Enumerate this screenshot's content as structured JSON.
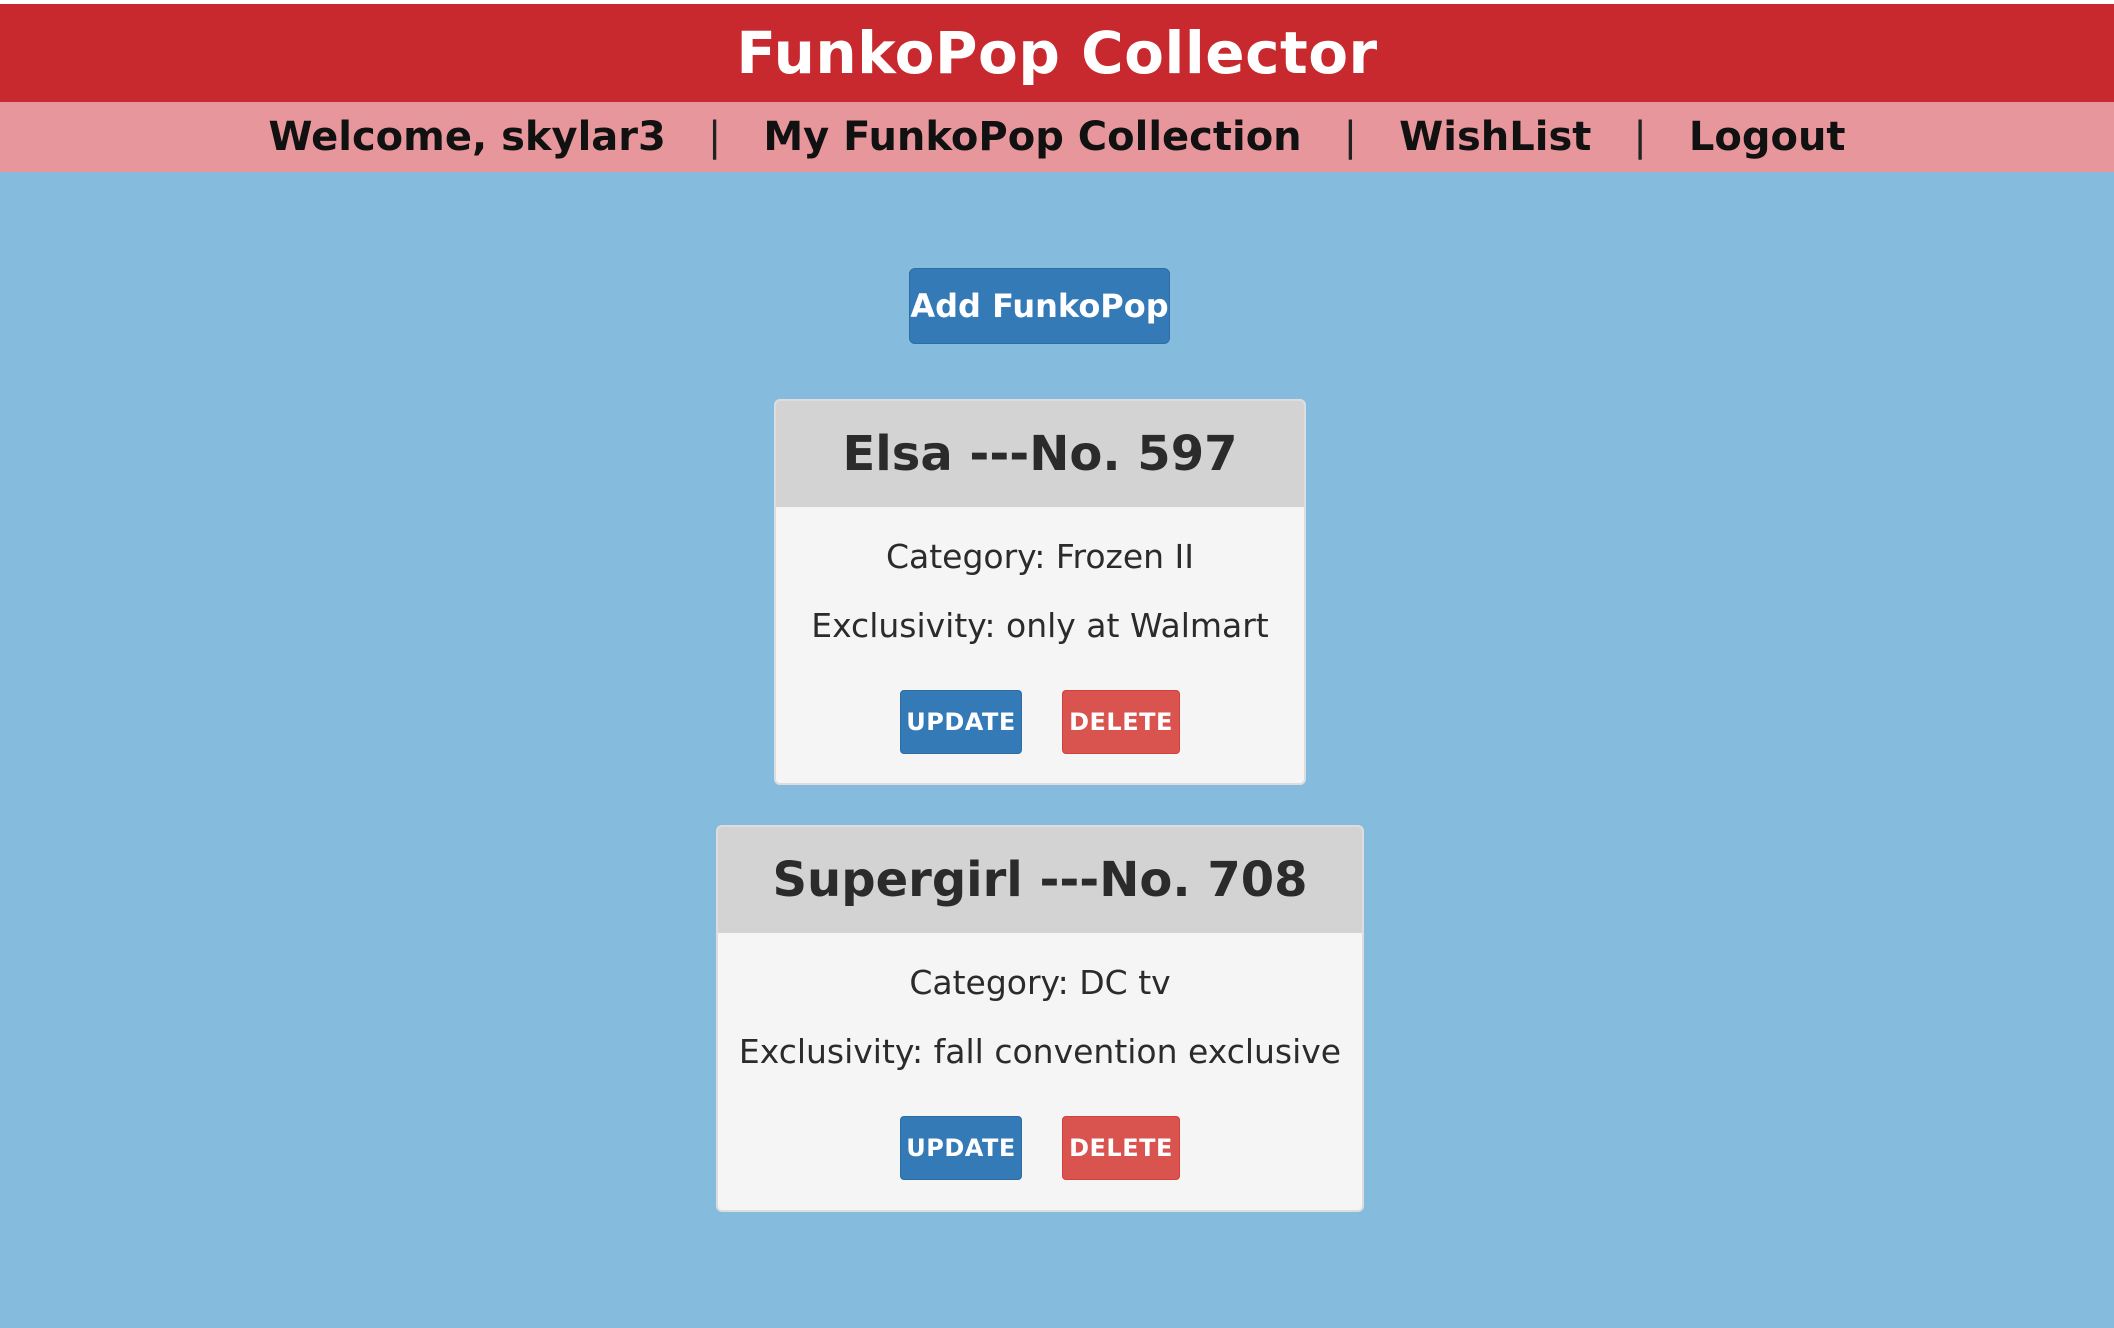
{
  "header": {
    "title": "FunkoPop Collector"
  },
  "nav": {
    "welcome": "Welcome, skylar3",
    "collection": "My FunkoPop Collection",
    "wishlist": "WishList",
    "logout": "Logout",
    "separator": "|"
  },
  "actions": {
    "add_label": "Add FunkoPop"
  },
  "funkopops": [
    {
      "title": "Elsa ---No. 597",
      "category": "Category: Frozen II",
      "exclusivity": "Exclusivity: only at Walmart",
      "update_label": "UPDATE",
      "delete_label": "DELETE"
    },
    {
      "title": "Supergirl ---No. 708",
      "category": "Category: DC tv",
      "exclusivity": "Exclusivity: fall convention exclusive",
      "update_label": "UPDATE",
      "delete_label": "DELETE"
    }
  ],
  "colors": {
    "header_red": "#c8292f",
    "nav_pink": "#e7979b",
    "background_blue": "#85bcdd",
    "primary_button": "#337ab7",
    "danger_button": "#d9534f",
    "card_header": "#d3d3d3",
    "card_body": "#f5f5f5"
  }
}
